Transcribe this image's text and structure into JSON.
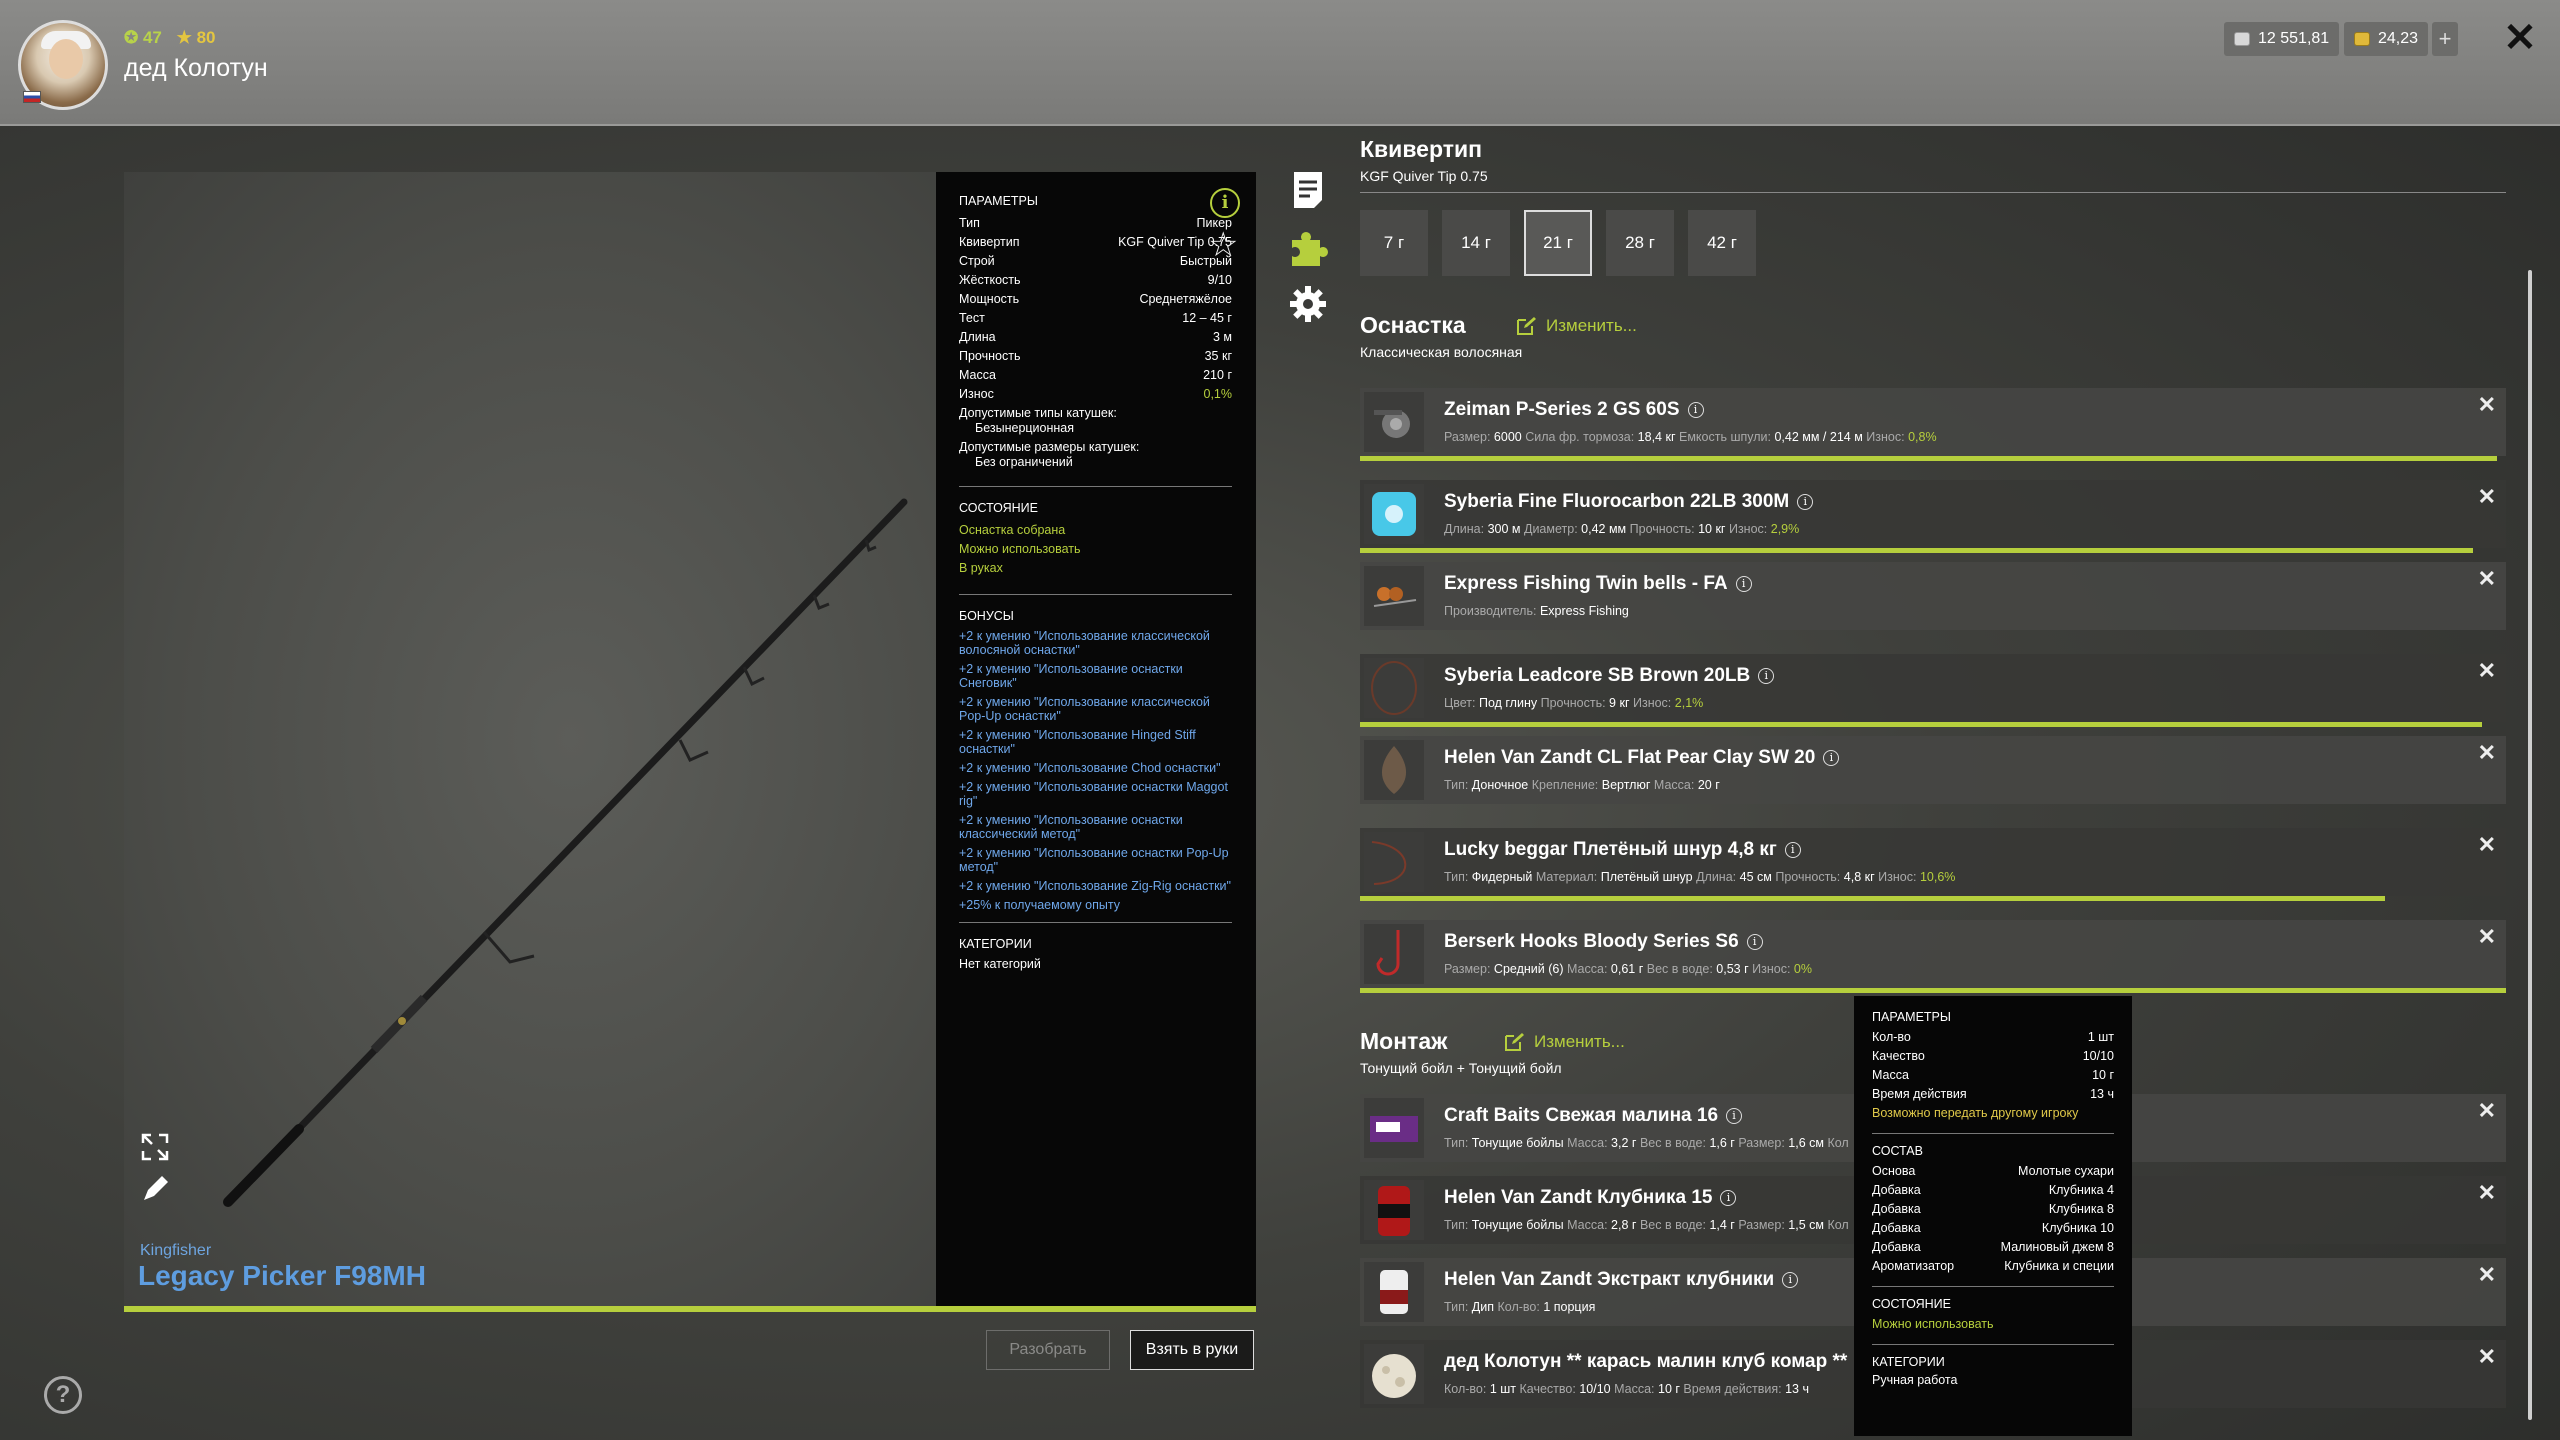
{
  "header": {
    "username": "дед Колотун",
    "level_green": "47",
    "level_yellow": "80",
    "silver": "12 551,81",
    "gold": "24,23",
    "plus": "+",
    "close": "✕"
  },
  "rod": {
    "brand": "Kingfisher",
    "model": "Legacy Picker F98MH"
  },
  "params": {
    "title": "ПАРАМЕТРЫ",
    "rows": [
      {
        "k": "Тип",
        "v": "Пикер"
      },
      {
        "k": "Квивертип",
        "v": "KGF Quiver Tip 0.75"
      },
      {
        "k": "Строй",
        "v": "Быстрый"
      },
      {
        "k": "Жёсткость",
        "v": "9/10"
      },
      {
        "k": "Мощность",
        "v": "Среднетяжёлое"
      },
      {
        "k": "Тест",
        "v": "12 – 45 г"
      },
      {
        "k": "Длина",
        "v": "3 м"
      },
      {
        "k": "Прочность",
        "v": "35 кг"
      },
      {
        "k": "Масса",
        "v": "210 г"
      },
      {
        "k": "Износ",
        "v": "0,1%"
      }
    ],
    "reels_types_label": "Допустимые типы катушек:",
    "reels_types_value": "Безынерционная",
    "reels_sizes_label": "Допустимые размеры катушек:",
    "reels_sizes_value": "Без ограничений",
    "state_title": "СОСТОЯНИЕ",
    "state": [
      "Оснастка собрана",
      "Можно использовать",
      "В руках"
    ],
    "bonus_title": "БОНУСЫ",
    "bonuses": [
      "+2 к умению \"Использование классической волосяной оснастки\"",
      "+2 к умению \"Использование оснастки Снеговик\"",
      "+2 к умению \"Использование классической Pop-Up оснастки\"",
      "+2 к умению \"Использование Hinged Stiff оснастки\"",
      "+2 к умению \"Использование Chod оснастки\"",
      "+2 к умению \"Использование оснастки Maggot rig\"",
      "+2 к умению \"Использование оснастки классический метод\"",
      "+2 к умению \"Использование оснастки Pop-Up метод\"",
      "+2 к умению \"Использование Zig-Rig оснастки\"",
      "+25% к получаемому опыту"
    ],
    "cat_title": "КАТЕГОРИИ",
    "cat_value": "Нет категорий"
  },
  "quiver": {
    "title": "Квивертип",
    "subtitle": "KGF Quiver Tip 0.75",
    "tips": [
      "7 г",
      "14 г",
      "21 г",
      "28 г",
      "42 г"
    ],
    "selected_index": 2
  },
  "tackle": {
    "title": "Оснастка",
    "edit": "Изменить...",
    "subtitle": "Классическая волосяная",
    "items": [
      {
        "name": "Zeiman P-Series 2 GS 60S",
        "meta": [
          [
            "Размер:",
            "6000"
          ],
          [
            "Сила фр. тормоза:",
            "18,4 кг"
          ],
          [
            "Емкость шпули:",
            "0,42 мм / 214 м"
          ],
          [
            "Износ:",
            "0,8%"
          ]
        ],
        "wear": 0.992
      },
      {
        "name": "Syberia Fine Fluorocarbon 22LB 300M",
        "meta": [
          [
            "Длина:",
            "300 м"
          ],
          [
            "Диаметр:",
            "0,42 мм"
          ],
          [
            "Прочность:",
            "10 кг"
          ],
          [
            "Износ:",
            "2,9%"
          ]
        ],
        "wear": 0.971
      },
      {
        "name": "Express Fishing Twin bells - FA",
        "meta": [
          [
            "Производитель:",
            "Express Fishing"
          ]
        ]
      },
      {
        "name": "Syberia Leadcore SB Brown 20LB",
        "meta": [
          [
            "Цвет:",
            "Под глину"
          ],
          [
            "Прочность:",
            "9 кг"
          ],
          [
            "Износ:",
            "2,1%"
          ]
        ],
        "wear": 0.979
      },
      {
        "name": "Helen Van Zandt CL Flat Pear Clay SW 20",
        "meta": [
          [
            "Тип:",
            "Доночное"
          ],
          [
            "Крепление:",
            "Вертлюг"
          ],
          [
            "Масса:",
            "20 г"
          ]
        ]
      },
      {
        "name": "Lucky beggar Плетёный шнур 4,8 кг",
        "meta": [
          [
            "Тип:",
            "Фидерный"
          ],
          [
            "Материал:",
            "Плетёный шнур"
          ],
          [
            "Длина:",
            "45 см"
          ],
          [
            "Прочность:",
            "4,8 кг"
          ],
          [
            "Износ:",
            "10,6%"
          ]
        ],
        "wear": 0.894
      },
      {
        "name": "Berserk Hooks Bloody Series S6",
        "meta": [
          [
            "Размер:",
            "Средний (6)"
          ],
          [
            "Масса:",
            "0,61 г"
          ],
          [
            "Вес в воде:",
            "0,53 г"
          ],
          [
            "Износ:",
            "0%"
          ]
        ],
        "wear": 1.0
      }
    ]
  },
  "mount": {
    "title": "Монтаж",
    "edit": "Изменить...",
    "subtitle": "Тонущий бойл + Тонущий бойл",
    "items": [
      {
        "name": "Craft Baits Свежая малина 16",
        "meta": [
          [
            "Тип:",
            "Тонущие бойлы"
          ],
          [
            "Масса:",
            "3,2 г"
          ],
          [
            "Вес в воде:",
            "1,6 г"
          ],
          [
            "Размер:",
            "1,6 см"
          ],
          [
            "Кол",
            ""
          ]
        ]
      },
      {
        "name": "Helen Van Zandt Клубника 15",
        "meta": [
          [
            "Тип:",
            "Тонущие бойлы"
          ],
          [
            "Масса:",
            "2,8 г"
          ],
          [
            "Вес в воде:",
            "1,4 г"
          ],
          [
            "Размер:",
            "1,5 см"
          ],
          [
            "Кол",
            ""
          ]
        ]
      },
      {
        "name": "Helen Van Zandt Экстракт клубники",
        "meta": [
          [
            "Тип:",
            "Дип"
          ],
          [
            "Кол-во:",
            "1 порция"
          ]
        ]
      },
      {
        "name": "дед Колотун ** карась малин клуб комар **",
        "meta": [
          [
            "Кол-во:",
            "1 шт"
          ],
          [
            "Качество:",
            "10/10"
          ],
          [
            "Масса:",
            "10 г"
          ],
          [
            "Время действия:",
            "13 ч"
          ]
        ]
      }
    ]
  },
  "tooltip": {
    "params_title": "ПАРАМЕТРЫ",
    "rows": [
      {
        "k": "Кол-во",
        "v": "1 шт"
      },
      {
        "k": "Качество",
        "v": "10/10"
      },
      {
        "k": "Масса",
        "v": "10 г"
      },
      {
        "k": "Время действия",
        "v": "13 ч"
      }
    ],
    "transfer": "Возможно передать другому игроку",
    "comp_title": "СОСТАВ",
    "comp": [
      {
        "k": "Основа",
        "v": "Молотые сухари"
      },
      {
        "k": "Добавка",
        "v": "Клубника 4"
      },
      {
        "k": "Добавка",
        "v": "Клубника 8"
      },
      {
        "k": "Добавка",
        "v": "Клубника 10"
      },
      {
        "k": "Добавка",
        "v": "Малиновый джем 8"
      },
      {
        "k": "Ароматизатор",
        "v": "Клубника и специи"
      }
    ],
    "state_title": "СОСТОЯНИЕ",
    "state": "Можно использовать",
    "cat_title": "КАТЕГОРИИ",
    "cat": "Ручная работа"
  },
  "buttons": {
    "disassemble": "Разобрать",
    "take": "Взять в руки"
  },
  "icons": {
    "help": "?",
    "info": "i",
    "star": "☆"
  },
  "colors": {
    "accent_green": "#b6cf3d",
    "link_blue": "#6fa7ea"
  }
}
